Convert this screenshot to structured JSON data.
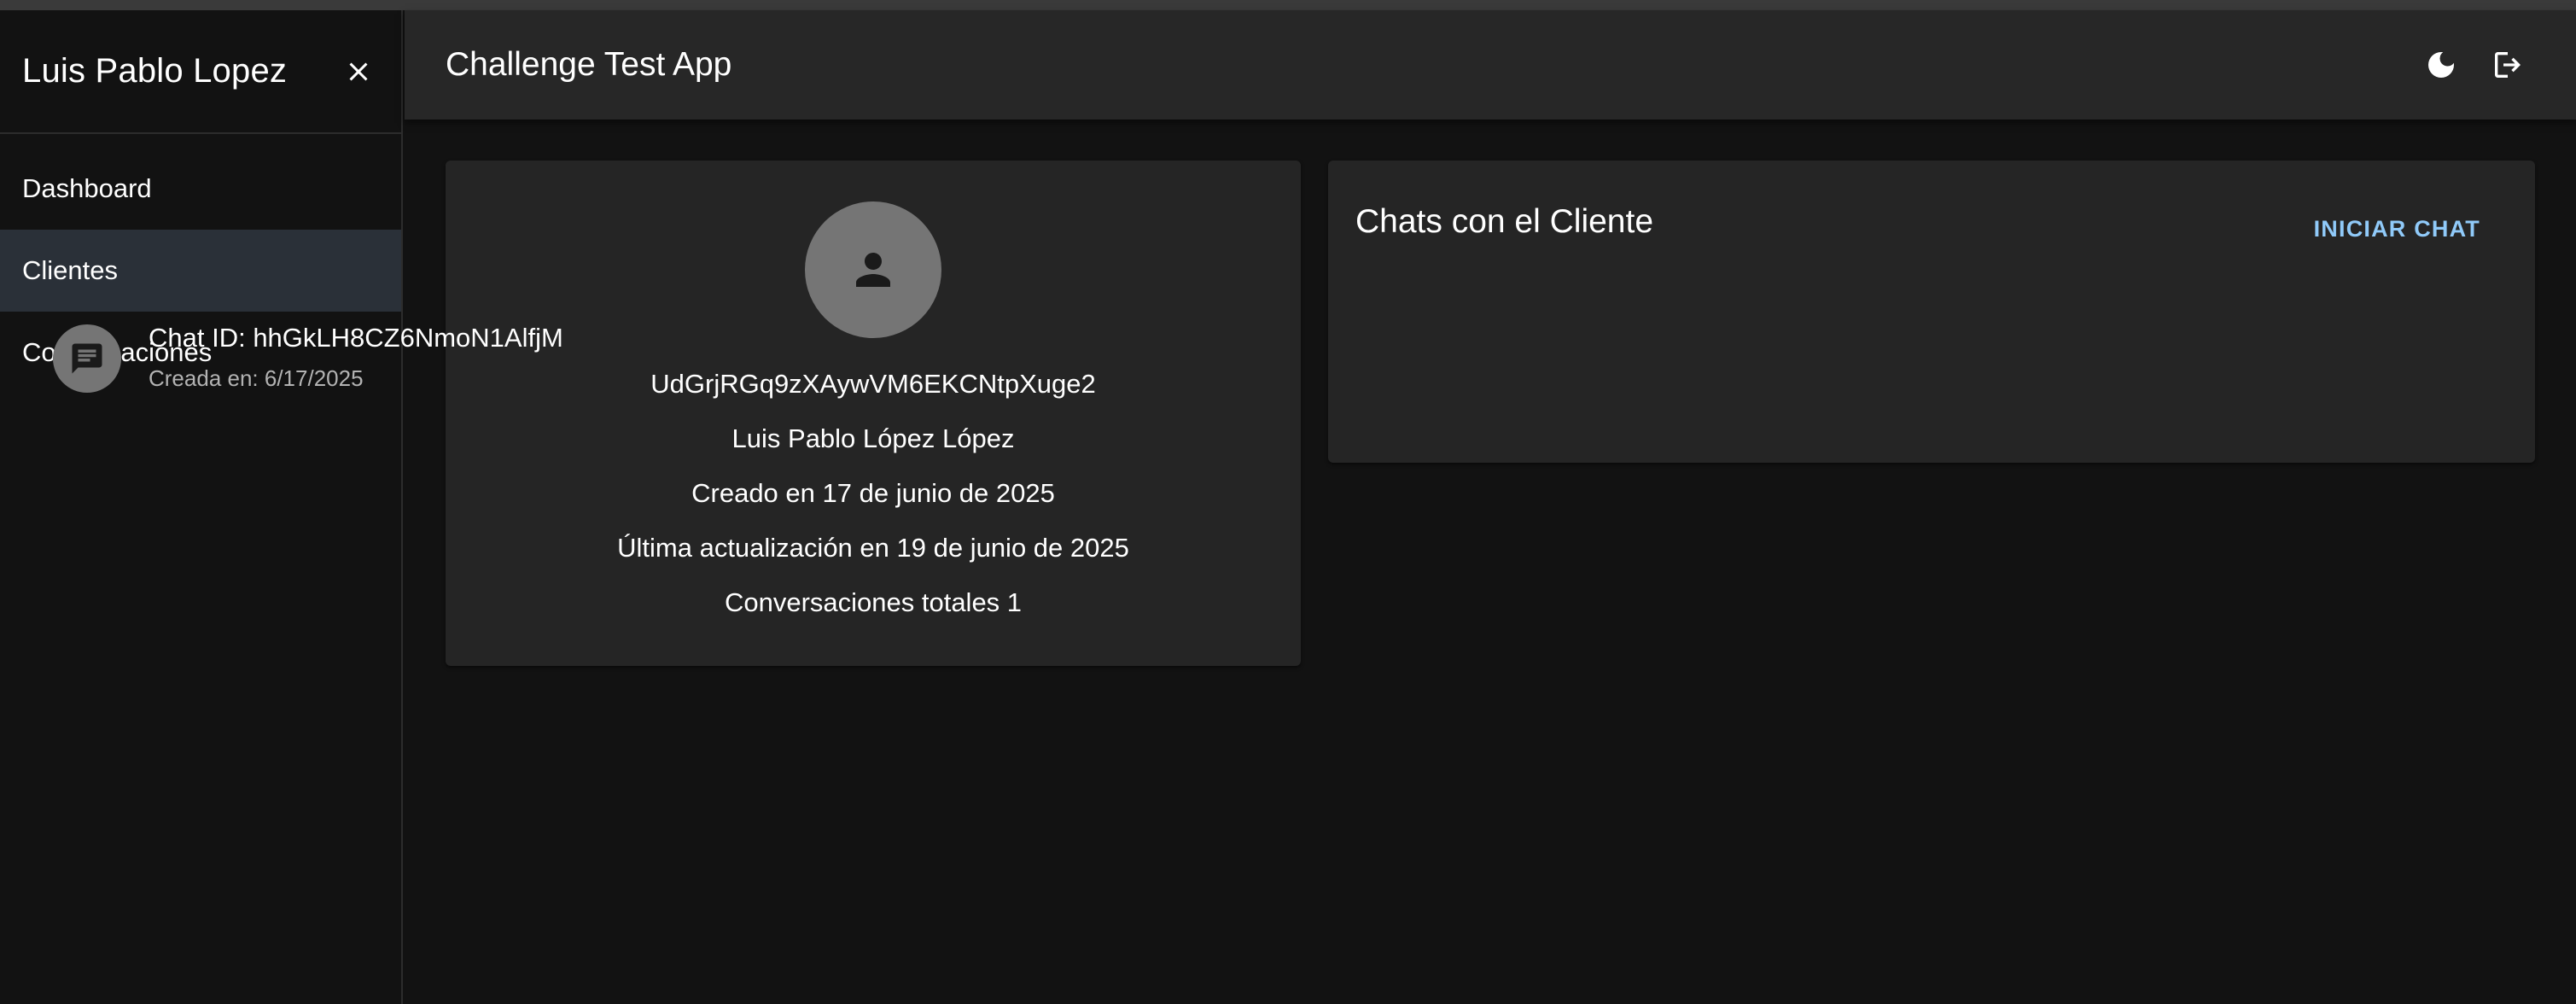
{
  "sidebar": {
    "user_name": "Luis Pablo Lopez",
    "items": [
      {
        "label": "Dashboard"
      },
      {
        "label": "Clientes"
      },
      {
        "label": "Conversaciones"
      }
    ],
    "active_item": "Clientes"
  },
  "appbar": {
    "title": "Challenge Test App",
    "icons": [
      "moon-icon",
      "logout-icon"
    ]
  },
  "client": {
    "id": "UdGrjRGq9zXAywVM6EKCNtpXuge2",
    "name": "Luis Pablo López López",
    "created": "Creado en 17 de junio de 2025",
    "updated": "Última actualización en 19 de junio de 2025",
    "total_conversations": "Conversaciones totales 1"
  },
  "chats": {
    "title": "Chats con el Cliente",
    "start_button": "INICIAR CHAT",
    "items": [
      {
        "primary": "Chat ID: hhGkLH8CZ6NmoN1AlfjM",
        "secondary": "Creada en: 6/17/2025"
      }
    ]
  },
  "colors": {
    "background": "#121212",
    "card": "#252525",
    "appbar": "#272727",
    "accent": "#90caf9",
    "active_nav": "#2a3038",
    "avatar": "#757575"
  }
}
